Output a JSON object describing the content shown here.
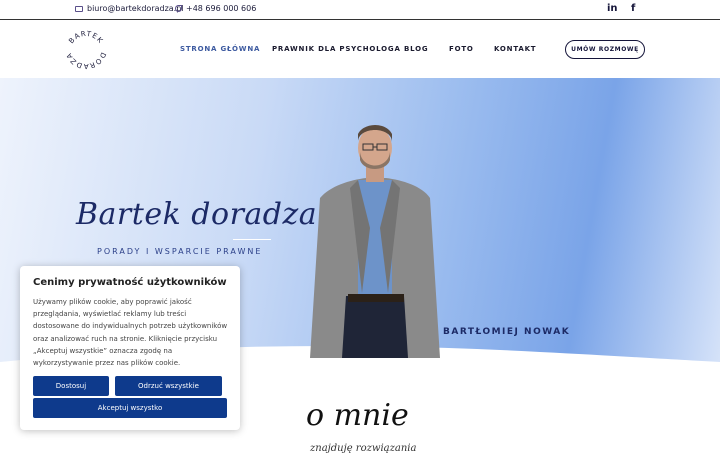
{
  "topbar": {
    "email": "biuro@bartekdoradza.pl",
    "phone": "+48 696 000 606",
    "social_linkedin": "in",
    "social_facebook": "f"
  },
  "logo": {
    "top_text": "BARTEK",
    "bottom_text": "DORADZA"
  },
  "nav": {
    "items": [
      {
        "label": "STRONA GŁÓWNA",
        "active": true
      },
      {
        "label": "PRAWNIK DLA PSYCHOLOGA",
        "active": false
      },
      {
        "label": "BLOG",
        "active": false
      },
      {
        "label": "FOTO",
        "active": false
      },
      {
        "label": "KONTAKT",
        "active": false
      }
    ],
    "cta_label": "UMÓW ROZMOWĘ"
  },
  "hero": {
    "script_title": "Bartek doradza",
    "subtitle": "PORADY I WSPARCIE PRAWNE",
    "person_name": "BARTŁOMIEJ NOWAK"
  },
  "about": {
    "title": "o mnie",
    "subtitle": "znajduję rozwiązania"
  },
  "cookie": {
    "title": "Cenimy prywatność użytkowników",
    "text": "Używamy plików cookie, aby poprawić jakość przeglądania, wyświetlać reklamy lub treści dostosowane do indywidualnych potrzeb użytkowników oraz analizować ruch na stronie. Kliknięcie przycisku „Akceptuj wszystkie” oznacza zgodę na wykorzystywanie przez nas plików cookie.",
    "customize_label": "Dostosuj",
    "reject_label": "Odrzuć wszystkie",
    "accept_label": "Akceptuj wszystko"
  },
  "colors": {
    "brand_navy": "#15153a",
    "active_nav": "#3d5aa0",
    "cookie_button": "#0e3a8c"
  }
}
